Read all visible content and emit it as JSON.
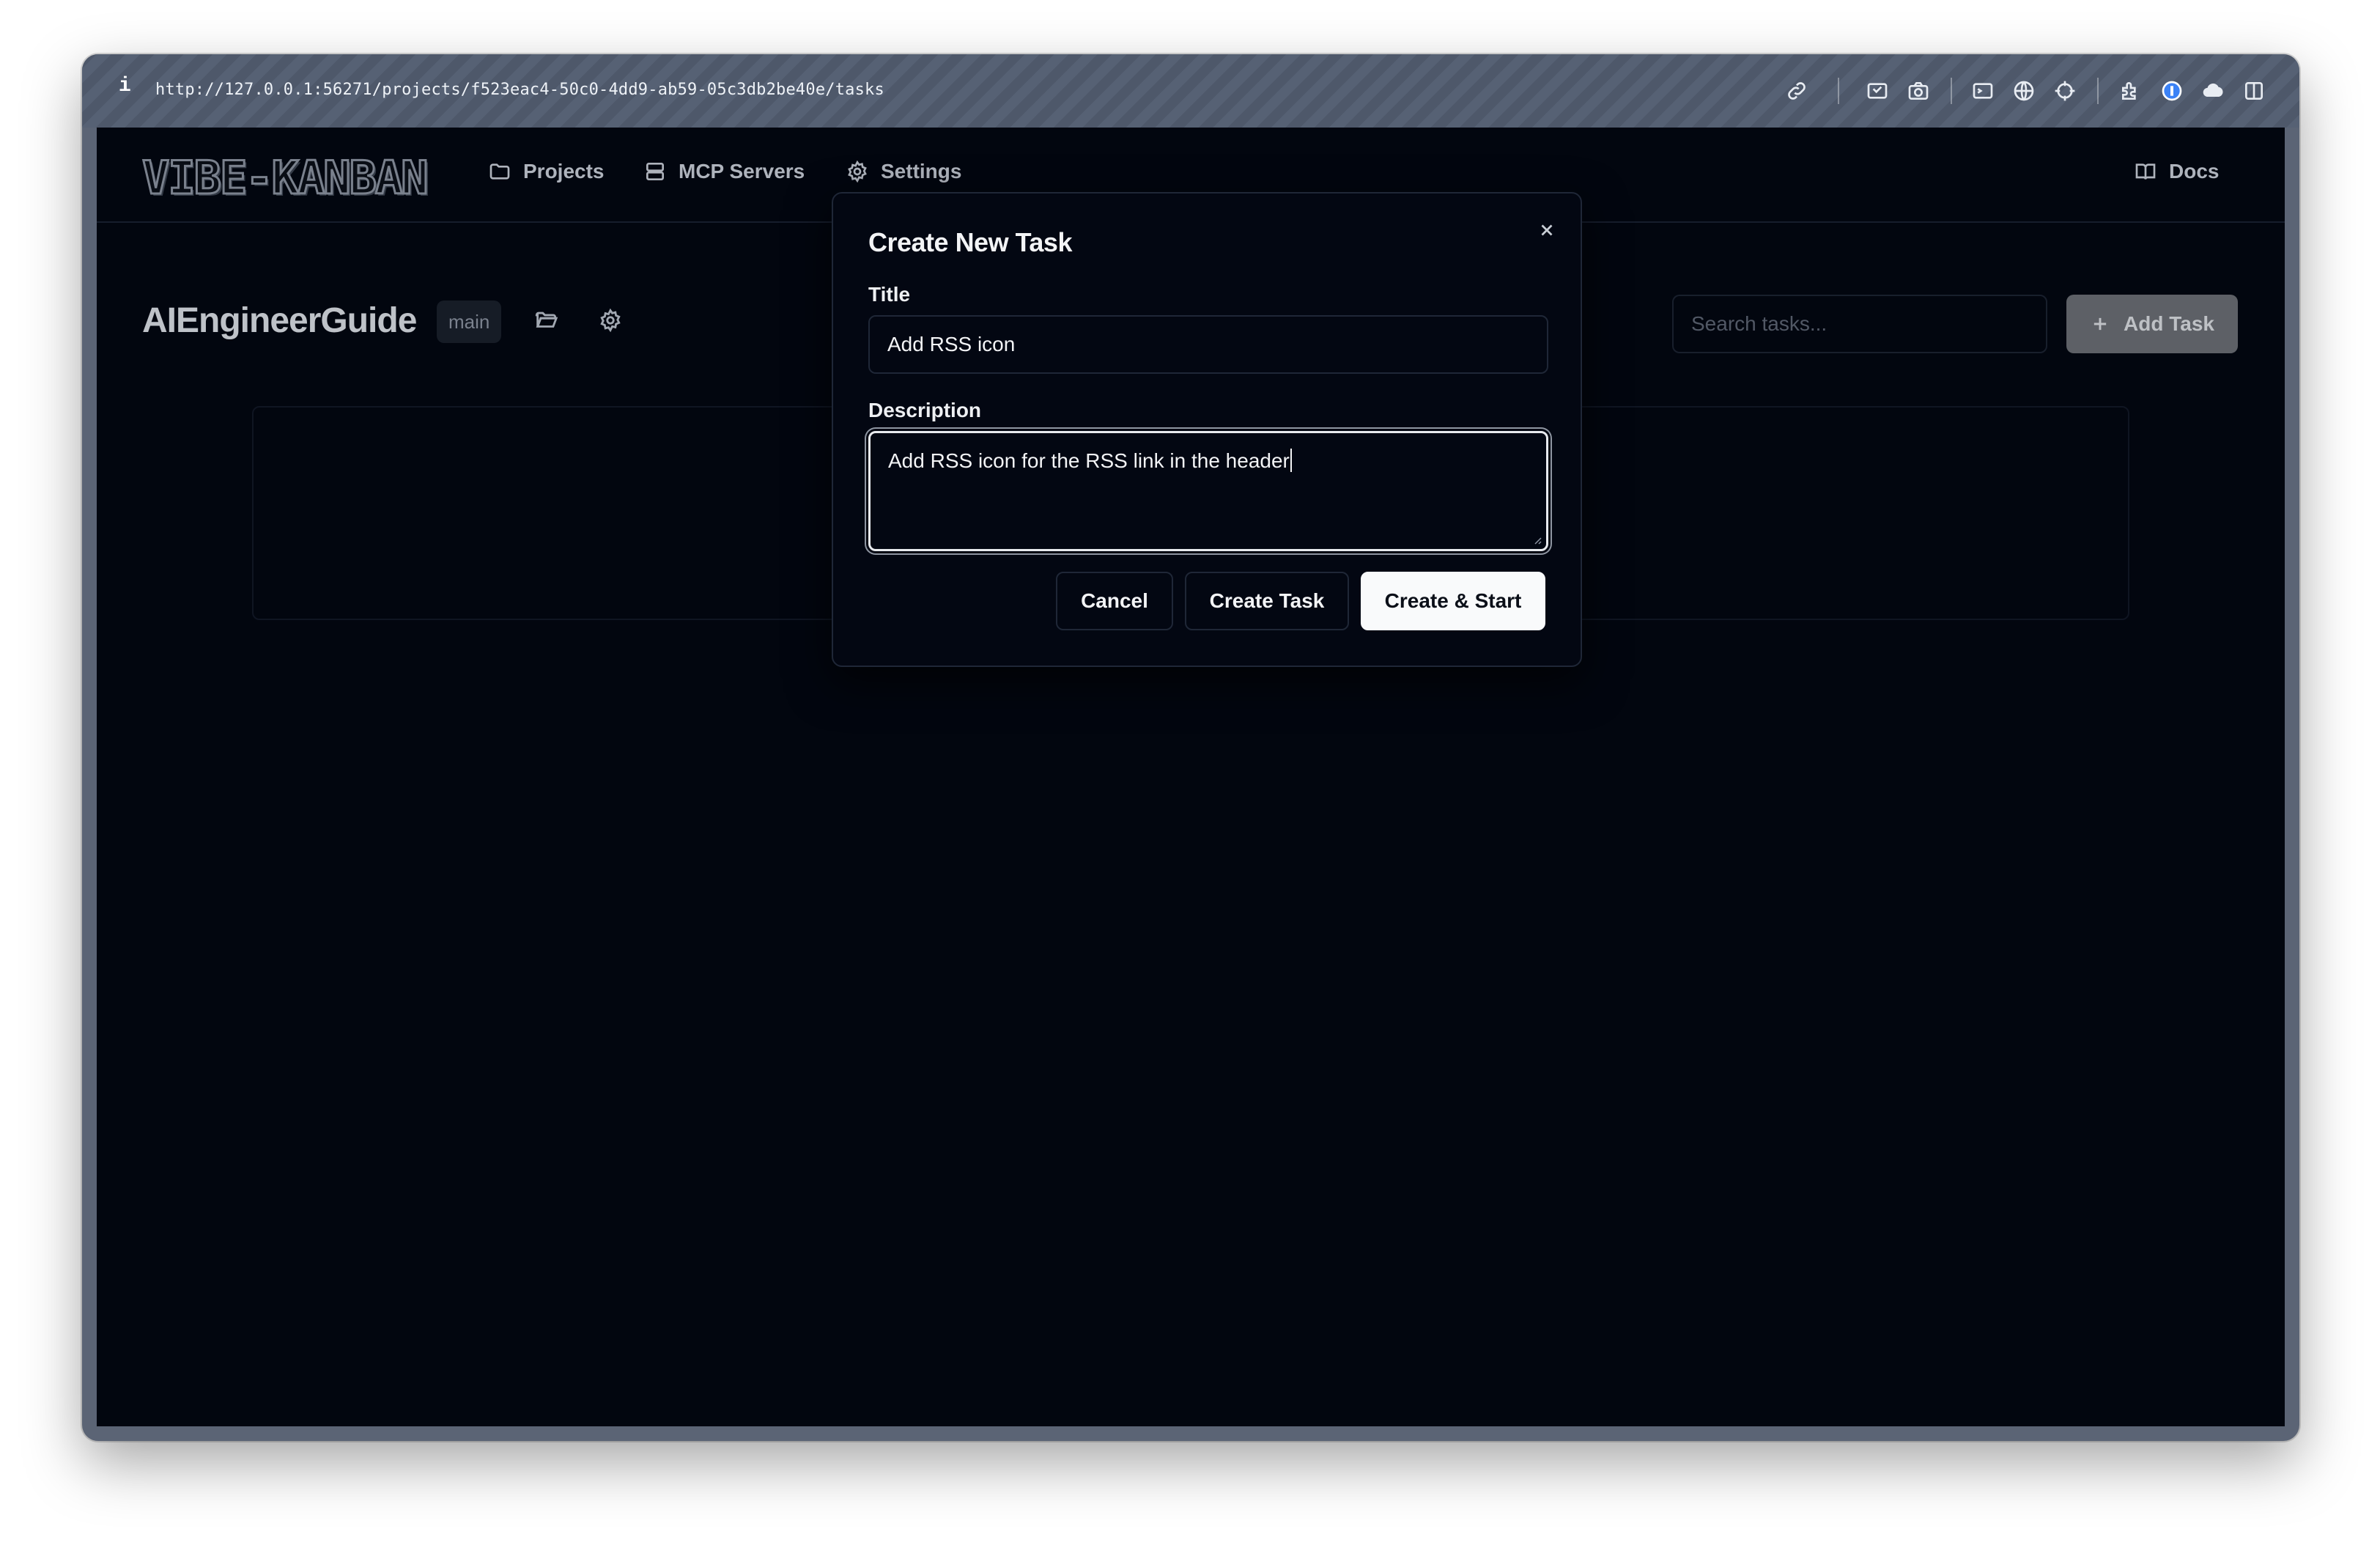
{
  "browser": {
    "info_glyph": "i",
    "url": "http://127.0.0.1:56271/projects/f523eac4-50c0-4dd9-ab59-05c3db2be40e/tasks",
    "toolbar_icons": [
      "link-icon",
      "picture-in-picture-icon",
      "camera-icon",
      "terminal-icon",
      "globe-icon",
      "crosshair-icon",
      "extension-icon",
      "password-manager-icon",
      "cloud-icon",
      "sidebar-icon"
    ]
  },
  "nav": {
    "logo": "VIBE-KANBAN",
    "items": [
      {
        "label": "Projects",
        "icon": "folder-icon"
      },
      {
        "label": "MCP Servers",
        "icon": "server-icon"
      },
      {
        "label": "Settings",
        "icon": "gear-icon"
      }
    ],
    "docs_label": "Docs"
  },
  "project": {
    "name": "AIEngineerGuide",
    "branch": "main"
  },
  "search": {
    "placeholder": "Search tasks..."
  },
  "add_task_label": "Add Task",
  "modal": {
    "title": "Create New Task",
    "title_label": "Title",
    "title_value": "Add RSS icon",
    "description_label": "Description",
    "description_value": "Add RSS icon for the RSS link in the header",
    "cancel_label": "Cancel",
    "create_label": "Create Task",
    "create_start_label": "Create & Start"
  }
}
